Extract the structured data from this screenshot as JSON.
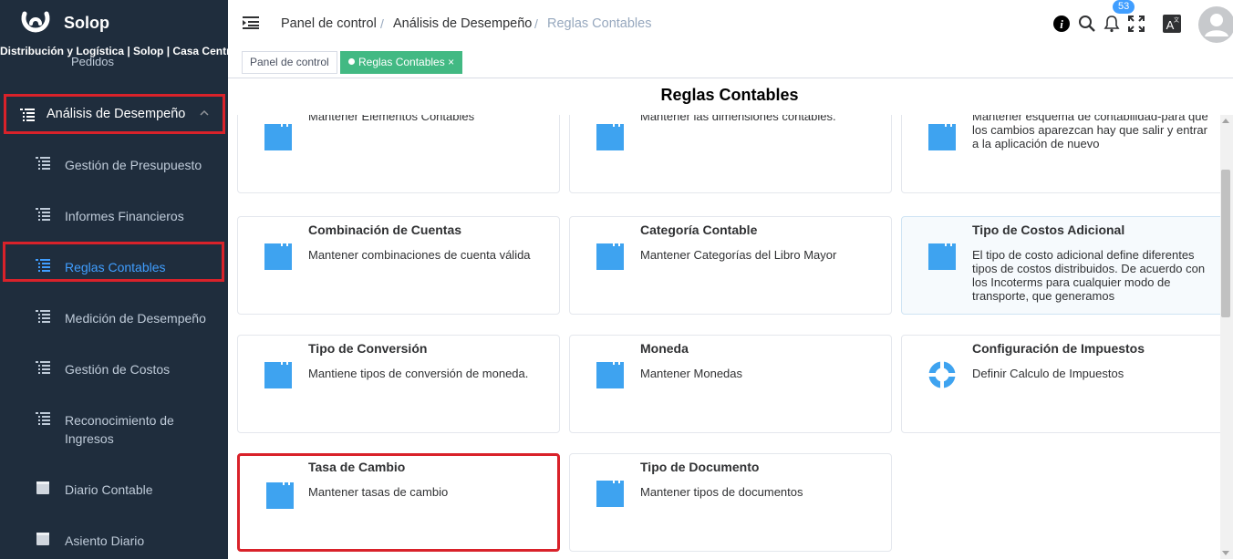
{
  "app": {
    "name": "Solop",
    "org_line": "Distribución y Logística | Solop | Casa Central",
    "cut_off_item": "Pedidos"
  },
  "sidebar": {
    "parent_label": "Análisis de Desempeño",
    "items": [
      {
        "label": "Gestión de Presupuesto",
        "icon": "list-icon"
      },
      {
        "label": "Informes Financieros",
        "icon": "list-icon"
      },
      {
        "label": "Reglas Contables",
        "icon": "list-icon",
        "active": true
      },
      {
        "label": "Medición de Desempeño",
        "icon": "list-icon"
      },
      {
        "label": "Gestión de Costos",
        "icon": "list-icon"
      },
      {
        "label": "Reconocimiento de Ingresos",
        "icon": "list-icon"
      },
      {
        "label": "Diario Contable",
        "icon": "folder-icon"
      },
      {
        "label": "Asiento Diario",
        "icon": "folder-icon"
      }
    ]
  },
  "breadcrumb": [
    "Panel de control",
    "Análisis de Desempeño",
    "Reglas Contables"
  ],
  "header": {
    "notification_count": "53"
  },
  "tags": {
    "home": "Panel de control",
    "active": "Reglas Contables",
    "close": "×"
  },
  "page_title": "Reglas Contables",
  "cards": [
    {
      "title": "",
      "desc": "Mantener Elementos Contables",
      "icon": "window-icon"
    },
    {
      "title": "",
      "desc": "Mantener las dimensiones contables.",
      "icon": "window-icon"
    },
    {
      "title": "",
      "desc": "Mantener esquema de contabilidad-para que los cambios aparezcan hay que salir y entrar a la aplicación de nuevo",
      "icon": "window-icon"
    },
    {
      "title": "Combinación de Cuentas",
      "desc": "Mantener combinaciones de cuenta válida",
      "icon": "window-icon"
    },
    {
      "title": "Categoría Contable",
      "desc": "Mantener Categorías del Libro Mayor",
      "icon": "window-icon"
    },
    {
      "title": "Tipo de Costos Adicional",
      "desc": "El tipo de costo adicional define diferentes tipos de costos distribuidos. De acuerdo con los Incoterms para cualquier modo de transporte, que generamos",
      "icon": "window-icon"
    },
    {
      "title": "Tipo de Conversión",
      "desc": "Mantiene tipos de conversión de moneda.",
      "icon": "window-icon"
    },
    {
      "title": "Moneda",
      "desc": "Mantener Monedas",
      "icon": "window-icon"
    },
    {
      "title": "Configuración de Impuestos",
      "desc": "Definir Calculo de Impuestos",
      "icon": "process-icon"
    },
    {
      "title": "Tasa de Cambio",
      "desc": "Mantener tasas de cambio",
      "icon": "window-icon"
    },
    {
      "title": "Tipo de Documento",
      "desc": "Mantener tipos de documentos",
      "icon": "window-icon"
    }
  ],
  "colors": {
    "sidebar_bg": "#1f2d3d",
    "active_text": "#409eff",
    "highlight_border": "#d9222a",
    "tag_active": "#42b983",
    "icon_blue": "#3ea3f0"
  }
}
